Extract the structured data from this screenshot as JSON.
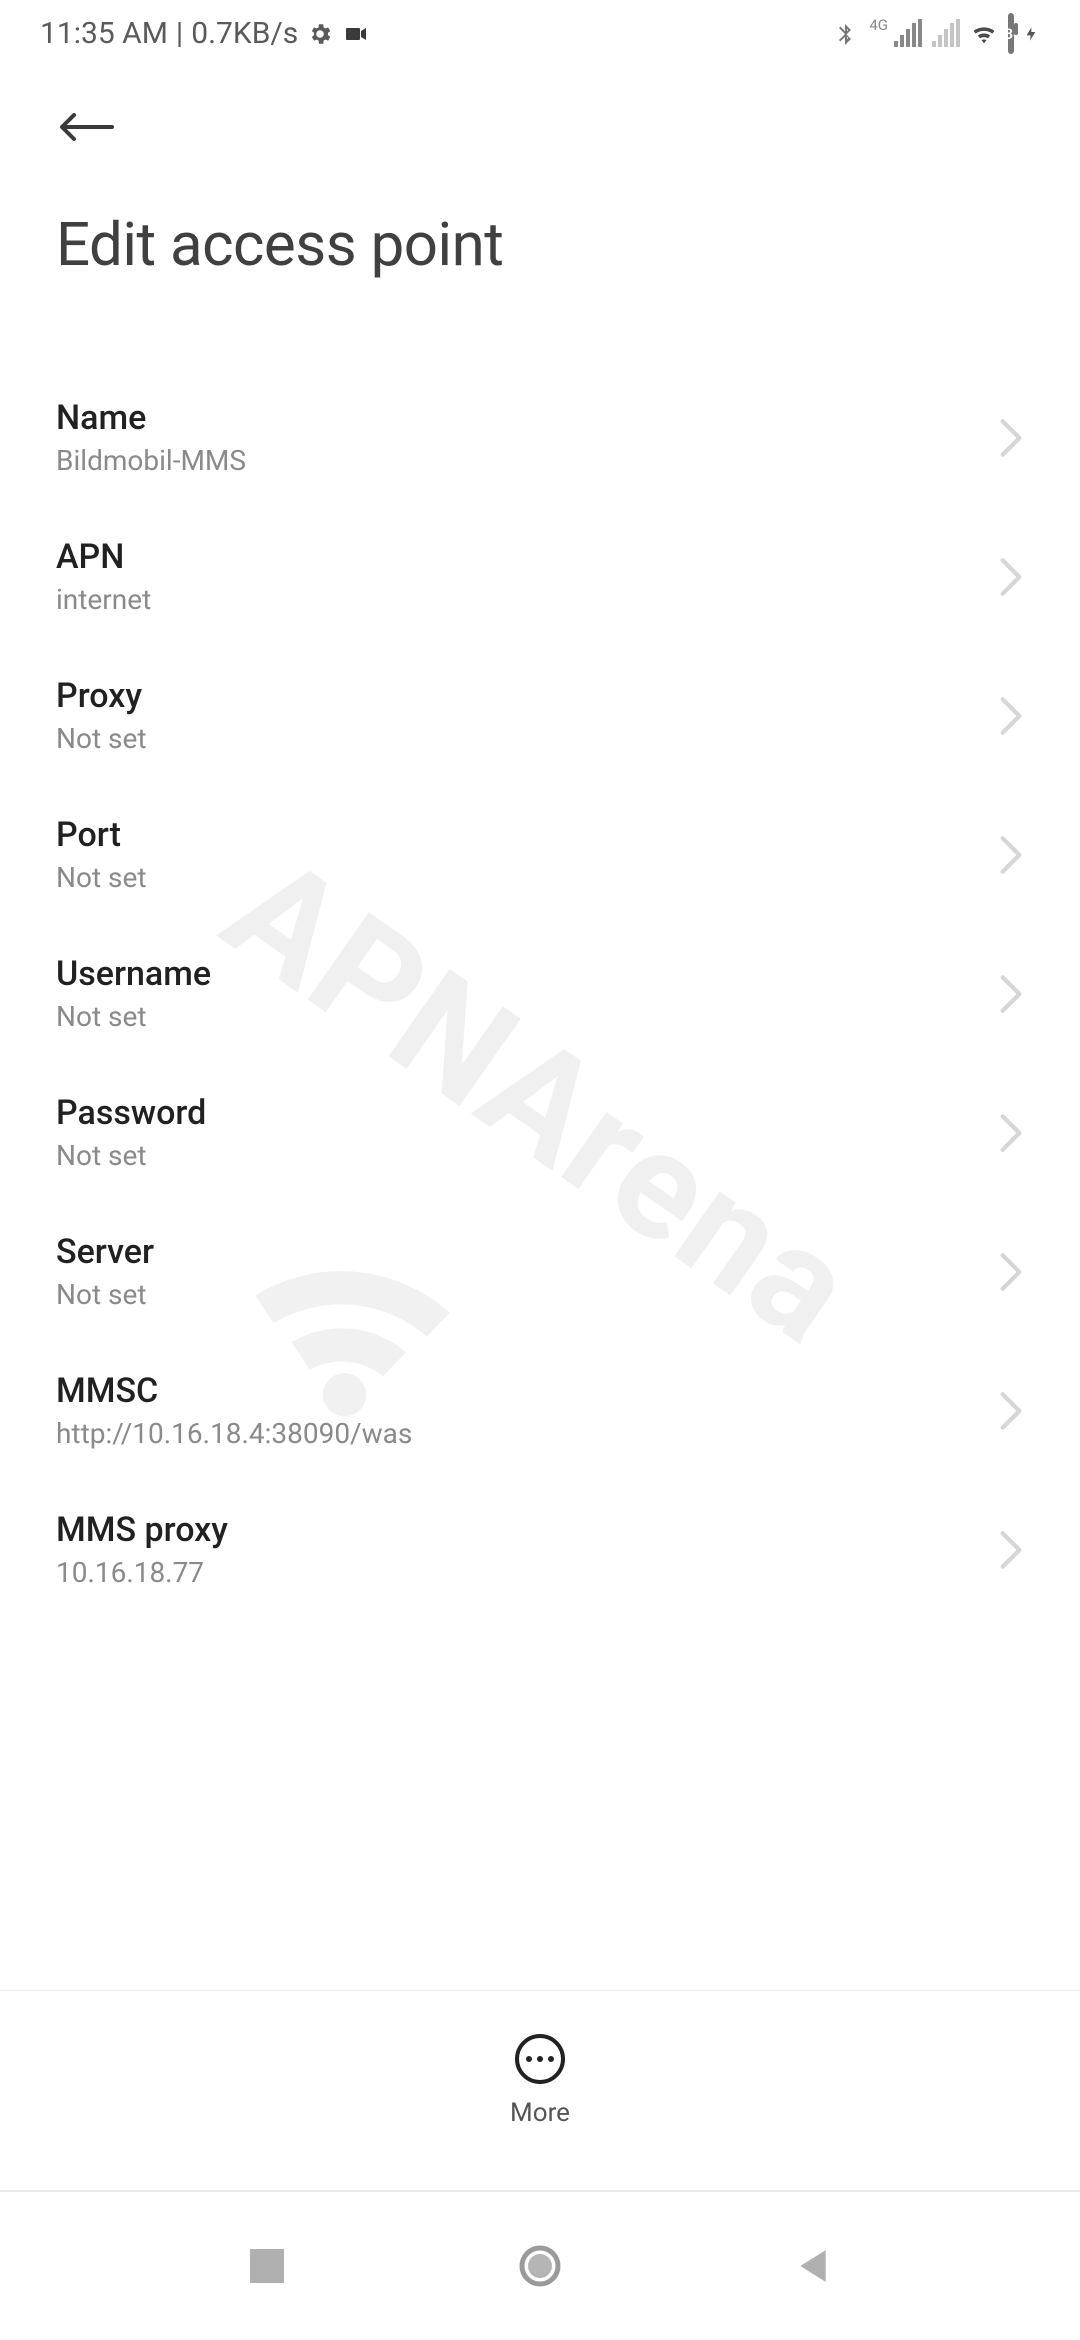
{
  "status": {
    "clock": "11:35 AM",
    "separator": " | ",
    "net_speed": "0.7KB/s",
    "battery_pct": "38"
  },
  "page_title": "Edit access point",
  "fields": [
    {
      "label": "Name",
      "value": "Bildmobil-MMS"
    },
    {
      "label": "APN",
      "value": "internet"
    },
    {
      "label": "Proxy",
      "value": "Not set"
    },
    {
      "label": "Port",
      "value": "Not set"
    },
    {
      "label": "Username",
      "value": "Not set"
    },
    {
      "label": "Password",
      "value": "Not set"
    },
    {
      "label": "Server",
      "value": "Not set"
    },
    {
      "label": "MMSC",
      "value": "http://10.16.18.4:38090/was"
    },
    {
      "label": "MMS proxy",
      "value": "10.16.18.77"
    }
  ],
  "more_label": "More",
  "watermark_text": "APNArena"
}
